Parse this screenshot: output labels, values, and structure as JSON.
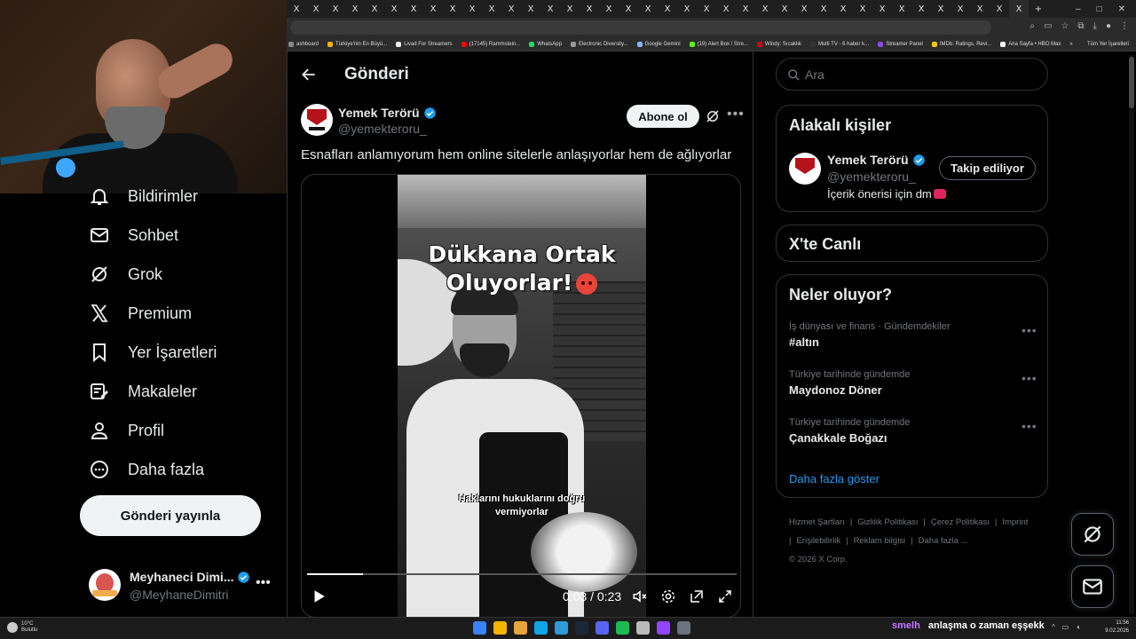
{
  "browser": {
    "tab_glyph": "X",
    "new_tab": "+",
    "bookmarks": [
      {
        "label": "ashboard",
        "color": "#888888"
      },
      {
        "label": "Türkiye'nin En Büyü...",
        "color": "#f5b400"
      },
      {
        "label": "Livad For Streamers",
        "color": "#eeeeee"
      },
      {
        "label": "(17145) Rammstein...",
        "color": "#ff0000"
      },
      {
        "label": "WhatsApp",
        "color": "#25d366"
      },
      {
        "label": "Electronic Diversity...",
        "color": "#999999"
      },
      {
        "label": "Google Gemini",
        "color": "#8ab4f8"
      },
      {
        "label": "(19) Alert Box / Stre...",
        "color": "#53fc18"
      },
      {
        "label": "Windy: Sıcaklık",
        "color": "#d0021b"
      },
      {
        "label": "Multi TV - 6 haber k...",
        "color": "#333333"
      },
      {
        "label": "Streamer Panel",
        "color": "#9146ff"
      },
      {
        "label": "IMDb: Ratings, Revi...",
        "color": "#f5c518"
      },
      {
        "label": "Ana Sayfa • HBO Max",
        "color": "#ffffff"
      }
    ],
    "bookmarks_overflow": "»",
    "all_bookmarks": "Tüm Yer İşaretleri"
  },
  "sidebar": {
    "items": [
      {
        "label": "Bildirimler",
        "icon": "bell-icon"
      },
      {
        "label": "Sohbet",
        "icon": "mail-icon"
      },
      {
        "label": "Grok",
        "icon": "grok-icon"
      },
      {
        "label": "Premium",
        "icon": "x-logo-icon"
      },
      {
        "label": "Yer İşaretleri",
        "icon": "bookmark-icon"
      },
      {
        "label": "Makaleler",
        "icon": "article-icon"
      },
      {
        "label": "Profil",
        "icon": "person-icon"
      },
      {
        "label": "Daha fazla",
        "icon": "more-circle-icon"
      }
    ],
    "post_button": "Gönderi yayınla",
    "account": {
      "name": "Meyhaneci Dimi...",
      "handle": "@MeyhaneDimitri",
      "more": "•••"
    }
  },
  "main": {
    "title": "Gönderi",
    "author": {
      "name": "Yemek Terörü",
      "handle": "@yemekteroru_"
    },
    "subscribe": "Abone ol",
    "more": "•••",
    "text": "Esnafları anlamıyorum hem online sitelerle anlaşıyorlar hem de ağlıyorlar",
    "video": {
      "headline_line1": "Dükkana Ortak",
      "headline_line2": "Oluyorlar!",
      "caption": "Haklarını hukuklarını doğru vermiyorlar",
      "time": "0:03 / 0:23",
      "progress": 0.13
    }
  },
  "right": {
    "search_placeholder": "Ara",
    "related": {
      "title": "Alakalı kişiler",
      "name": "Yemek Terörü",
      "handle": "@yemekteroru_",
      "bio": "İçerik önerisi için dm",
      "button": "Takip ediliyor"
    },
    "live_title": "X'te Canlı",
    "trends_title": "Neler oluyor?",
    "trends": [
      {
        "meta": "İş dünyası ve finans · Gündemdekiler",
        "name": "#altın"
      },
      {
        "meta": "Türkiye tarihinde gündemde",
        "name": "Maydonoz Döner"
      },
      {
        "meta": "Türkiye tarihinde gündemde",
        "name": "Çanakkale Boğazı"
      }
    ],
    "trend_more": "•••",
    "show_more": "Daha fazla göster",
    "footer": [
      "Hizmet Şartları",
      "|",
      "Gizlilik Politikası",
      "|",
      "Çerez Politikası",
      "|",
      "Imprint",
      "|",
      "Erişilebilirlik",
      "|",
      "Reklam bilgisi",
      "|",
      "Daha fazla ...",
      "© 2026 X Corp."
    ]
  },
  "taskbar": {
    "temperature": "10°C",
    "condition": "Bulutlu",
    "chat_user": "smelh",
    "chat_message": "anlaşma o zaman eşşekk",
    "time": "11:56",
    "date": "9.02.2026",
    "apps": [
      "#3b82f6",
      "#f4b400",
      "#e8a33d",
      "#0ea5e9",
      "#2f9bd6",
      "#1b2838",
      "#5865f2",
      "#1db954",
      "#bbbbbb",
      "#9146ff",
      "#6b7280"
    ]
  },
  "colors": {
    "accent": "#1d9bf0",
    "verified": "#1d9bf0",
    "background": "#000000"
  }
}
